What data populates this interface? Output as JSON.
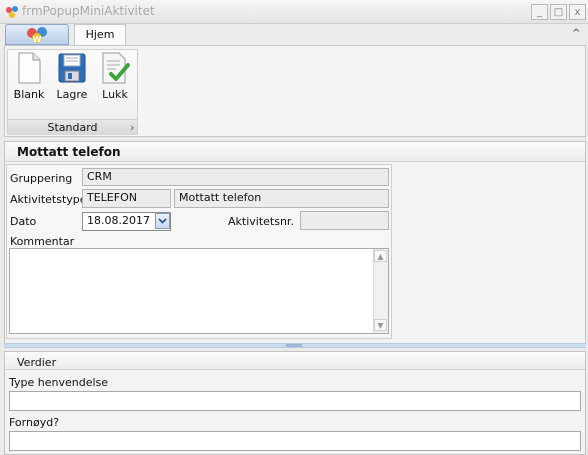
{
  "window": {
    "title": "frmPopupMiniAktivitet",
    "minimize": "_",
    "maximize": "□",
    "close": "x"
  },
  "ribbon": {
    "tabs": [
      {
        "label": "Hjem"
      }
    ],
    "collapse_glyph": "^",
    "group": {
      "caption": "Standard",
      "launcher_glyph": "›",
      "buttons": [
        {
          "label": "Blank",
          "icon": "blank-document-icon"
        },
        {
          "label": "Lagre",
          "icon": "floppy-save-icon"
        },
        {
          "label": "Lukk",
          "icon": "document-check-icon"
        }
      ]
    }
  },
  "panel": {
    "title": "Mottatt telefon",
    "fields": {
      "gruppering_label": "Gruppering",
      "gruppering_value": "CRM",
      "aktivitetstype_label": "Aktivitetstype",
      "aktivitetstype_code": "TELEFON",
      "aktivitetstype_desc": "Mottatt telefon",
      "dato_label": "Dato",
      "dato_value": "18.08.2017",
      "aktivitetsnr_label": "Aktivitetsnr.",
      "aktivitetsnr_value": "",
      "kommentar_label": "Kommentar",
      "kommentar_value": ""
    }
  },
  "bottom": {
    "title": "Verdier",
    "type_label": "Type henvendelse",
    "type_value": "",
    "fornoyd_label": "Fornøyd?",
    "fornoyd_value": ""
  },
  "colors": {
    "accent": "#2f6fb5",
    "ribbon_border": "#c7c7c7"
  }
}
